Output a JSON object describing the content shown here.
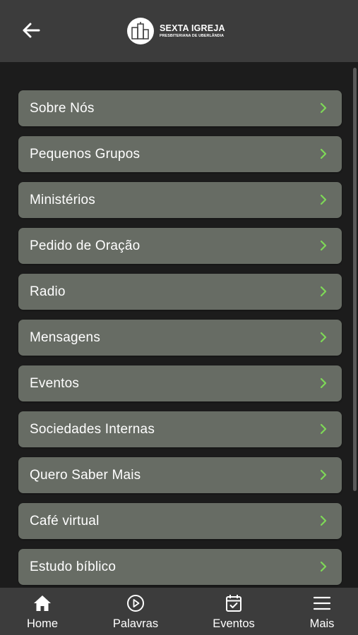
{
  "header": {
    "back_icon": "arrow-left-icon",
    "logo": {
      "title": "SEXTA IGREJA",
      "subtitle": "PRESBITERIANA DE UBERLÂNDIA"
    }
  },
  "menu": {
    "chevron_icon": "chevron-right-icon",
    "chevron_color": "#7ed957",
    "item_color": "#676c64",
    "items": [
      {
        "label": "Sobre Nós"
      },
      {
        "label": "Pequenos Grupos"
      },
      {
        "label": "Ministérios"
      },
      {
        "label": "Pedido de Oração"
      },
      {
        "label": "Radio"
      },
      {
        "label": "Mensagens"
      },
      {
        "label": "Eventos"
      },
      {
        "label": "Sociedades Internas"
      },
      {
        "label": "Quero Saber Mais"
      },
      {
        "label": "Café virtual"
      },
      {
        "label": "Estudo bíblico"
      }
    ]
  },
  "bottom_nav": {
    "items": [
      {
        "label": "Home",
        "icon": "home-icon"
      },
      {
        "label": "Palavras",
        "icon": "play-circle-icon"
      },
      {
        "label": "Eventos",
        "icon": "calendar-check-icon"
      },
      {
        "label": "Mais",
        "icon": "menu-icon"
      }
    ]
  }
}
